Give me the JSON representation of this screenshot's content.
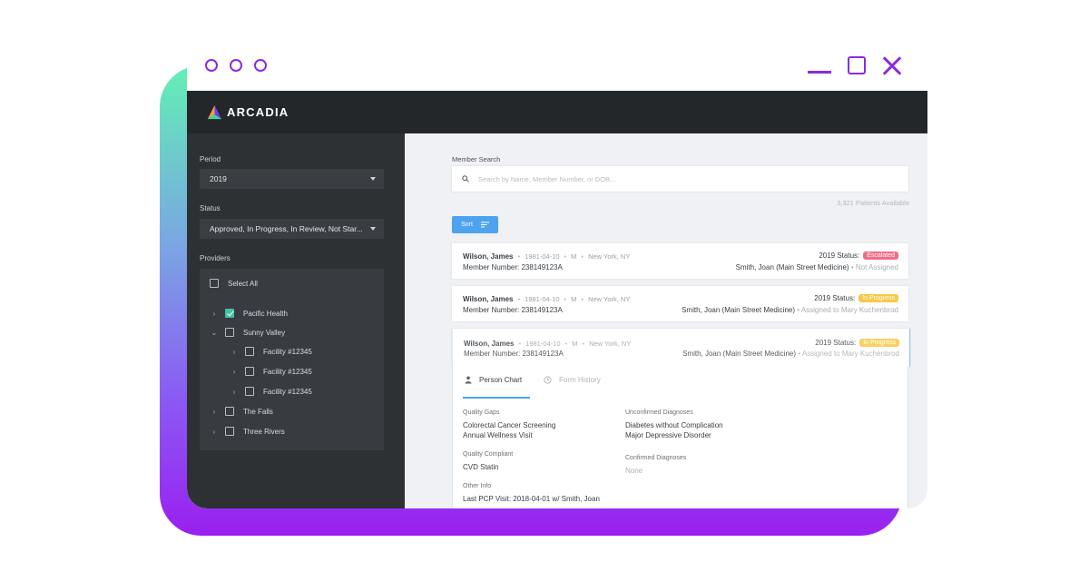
{
  "window": {
    "controls": [
      "minimize",
      "maximize",
      "close"
    ]
  },
  "brand": {
    "name": "ARCADIA",
    "text_color": "#ffffff"
  },
  "colors": {
    "accent": "#8a2be2",
    "primary_button": "#4ea3ee",
    "escalated": "#f06e87",
    "in_progress": "#f7c948",
    "check": "#3fc2a4"
  },
  "sidebar": {
    "period_label": "Period",
    "period_value": "2019",
    "status_label": "Status",
    "status_value": "Approved, In Progress, In Review, Not Star...",
    "providers_label": "Providers",
    "select_all": "Select All",
    "providers": [
      {
        "label": "Pacific Health",
        "checked": true,
        "expanded": false
      },
      {
        "label": "Sunny Valley",
        "checked": false,
        "expanded": true
      },
      {
        "label": "Facility #12345",
        "checked": false,
        "expanded": false
      },
      {
        "label": "Facility #12345",
        "checked": false,
        "expanded": false
      },
      {
        "label": "Facility #12345",
        "checked": false,
        "expanded": false
      },
      {
        "label": "The Falls",
        "checked": false,
        "expanded": false
      },
      {
        "label": "Three Rivers",
        "checked": false,
        "expanded": false
      }
    ]
  },
  "main": {
    "member_search_label": "Member Search",
    "search_placeholder": "Search by Name, Member Number, or DOB...",
    "patients_available": "3,321 Patients Available",
    "sort_label": "Sort",
    "cards": [
      {
        "name": "Wilson, James",
        "dob": "1981-04-10",
        "sex": "M",
        "location": "New York, NY",
        "member": "Member Number: 238149123A",
        "status_label": "2019 Status:",
        "badge": "Escalated",
        "badge_color": "#f06e87",
        "provider": "Smith, Joan (Main Street Medicine)",
        "assignment": "• Not Assigned"
      },
      {
        "name": "Wilson, James",
        "dob": "1981-04-10",
        "sex": "M",
        "location": "New York, NY",
        "member": "Member Number: 238149123A",
        "status_label": "2019 Status:",
        "badge": "In Progress",
        "badge_color": "#f7c948",
        "provider": "Smith, Joan (Main Street Medicine)",
        "assignment": "• Assigned to Mary Kuchenbrod"
      },
      {
        "name": "Wilson, James",
        "dob": "1981-04-10",
        "sex": "M",
        "location": "New York, NY",
        "member": "Member Number: 238149123A",
        "status_label": "2019 Status:",
        "badge": "In Progress",
        "badge_color": "#f7c948",
        "provider": "Smith, Joan (Main Street Medicine)",
        "assignment": "• Assigned to Mary Kuchenbrod"
      }
    ],
    "detail": {
      "tab_person_chart": "Person Chart",
      "tab_form_history": "Form History",
      "quality_gaps_title": "Quality Gaps",
      "quality_gaps": [
        "Colorectal Cancer Screening",
        "Annual Wellness Visit"
      ],
      "quality_compliant_title": "Quality Compliant",
      "quality_compliant": [
        "CVD Statin"
      ],
      "other_info_title": "Other Info",
      "other_info": [
        "Last PCP Visit: 2018-04-01 w/ Smith, Joan"
      ],
      "unconfirmed_title": "Unconfirmed Diagnoses",
      "unconfirmed": [
        "Diabetes without Complication",
        "Major Depressive Disorder"
      ],
      "confirmed_title": "Confirmed Diagnoses",
      "confirmed": [
        "None"
      ]
    }
  }
}
